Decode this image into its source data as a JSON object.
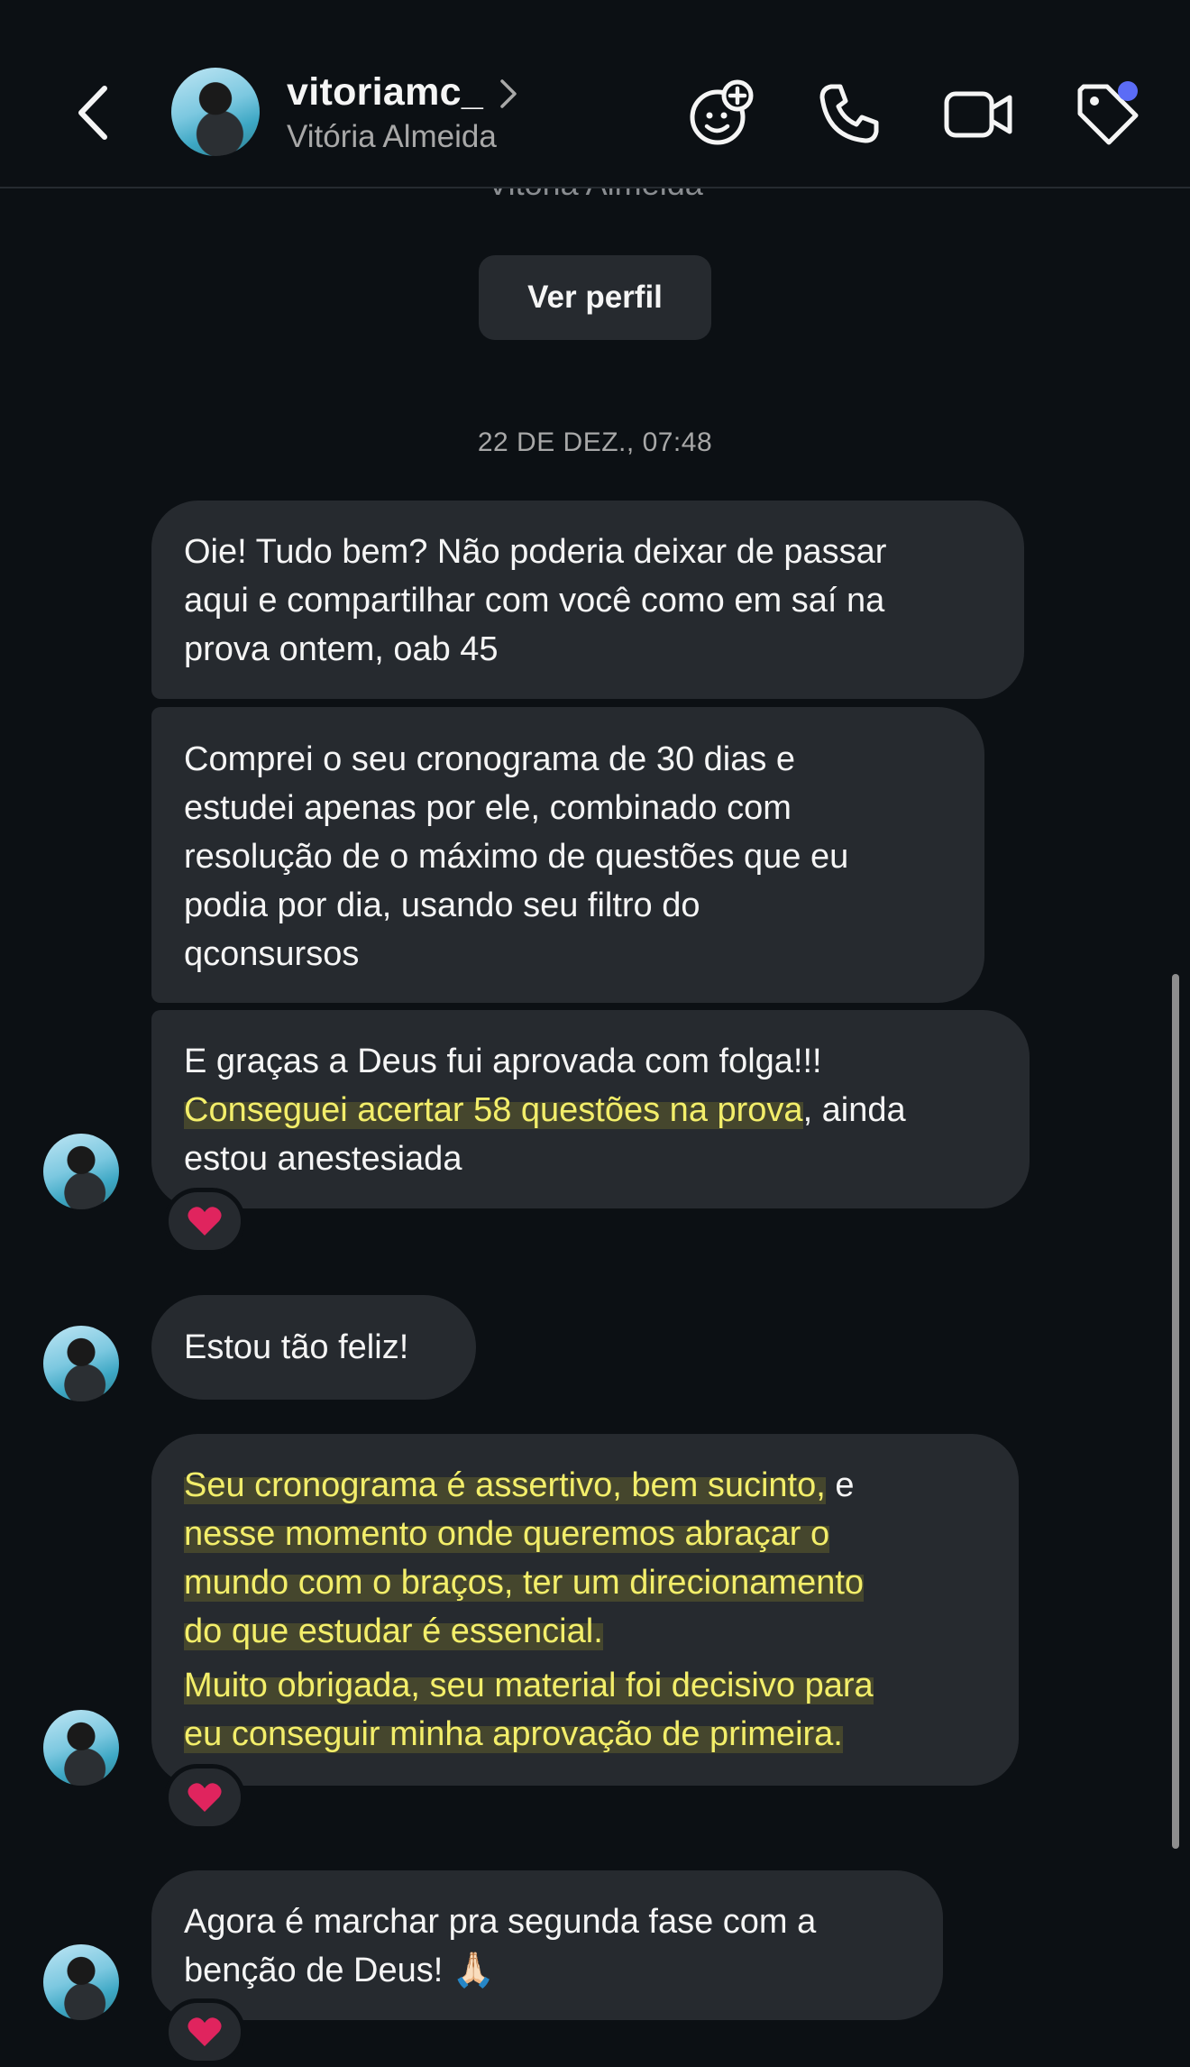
{
  "header": {
    "username": "vitoriamc_",
    "full_name": "Vitória Almeida"
  },
  "profile": {
    "partial_name": "Vitória Almeida",
    "button_label": "Ver perfil"
  },
  "timestamp": "22 DE DEZ., 07:48",
  "messages": [
    {
      "lines": [
        "Oie! Tudo bem? Não poderia deixar de passar",
        "aqui e compartilhar com você como em saí na",
        "prova ontem, oab 45"
      ]
    },
    {
      "lines": [
        "Comprei o seu cronograma de 30 dias e",
        "estudei apenas por ele, combinado com",
        "resolução de o máximo de questões que eu",
        "podia por dia, usando seu filtro do",
        "qconsursos"
      ]
    },
    {
      "line1": "E graças a Deus fui aprovada com folga!!!",
      "line2_highlight": "Conseguei acertar 58 questões na prova",
      "line2_rest": ", ainda",
      "line3": "estou anestesiada",
      "reaction": "heart"
    },
    {
      "text": "Estou tão feliz!"
    },
    {
      "lines_highlight": [
        "Seu cronograma é assertivo, bem sucinto,",
        "nesse momento onde queremos abraçar o",
        "mundo com o braços, ter um direcionamento",
        "do que estudar é essencial."
      ],
      "line1_suffix": " e",
      "lines2_highlight": [
        "Muito obrigada, seu material foi decisivo para",
        "eu conseguir minha aprovação de primeira."
      ],
      "reaction": "heart"
    },
    {
      "lines": [
        "Agora é marchar pra segunda fase com a",
        "benção de Deus! 🙏🏻"
      ],
      "reaction": "heart"
    }
  ],
  "icons": {
    "back": "chevron-left-icon",
    "profile_chevron": "chevron-right-icon",
    "sticker": "sticker-add-icon",
    "call": "phone-icon",
    "video": "video-camera-icon",
    "tag": "tag-icon",
    "reaction": "heart-icon"
  },
  "colors": {
    "background": "#0c1014",
    "bubble": "#262a2f",
    "highlight_text": "#f3ee6a",
    "notification_dot": "#5b6cf6",
    "heart": "#e0245e"
  }
}
